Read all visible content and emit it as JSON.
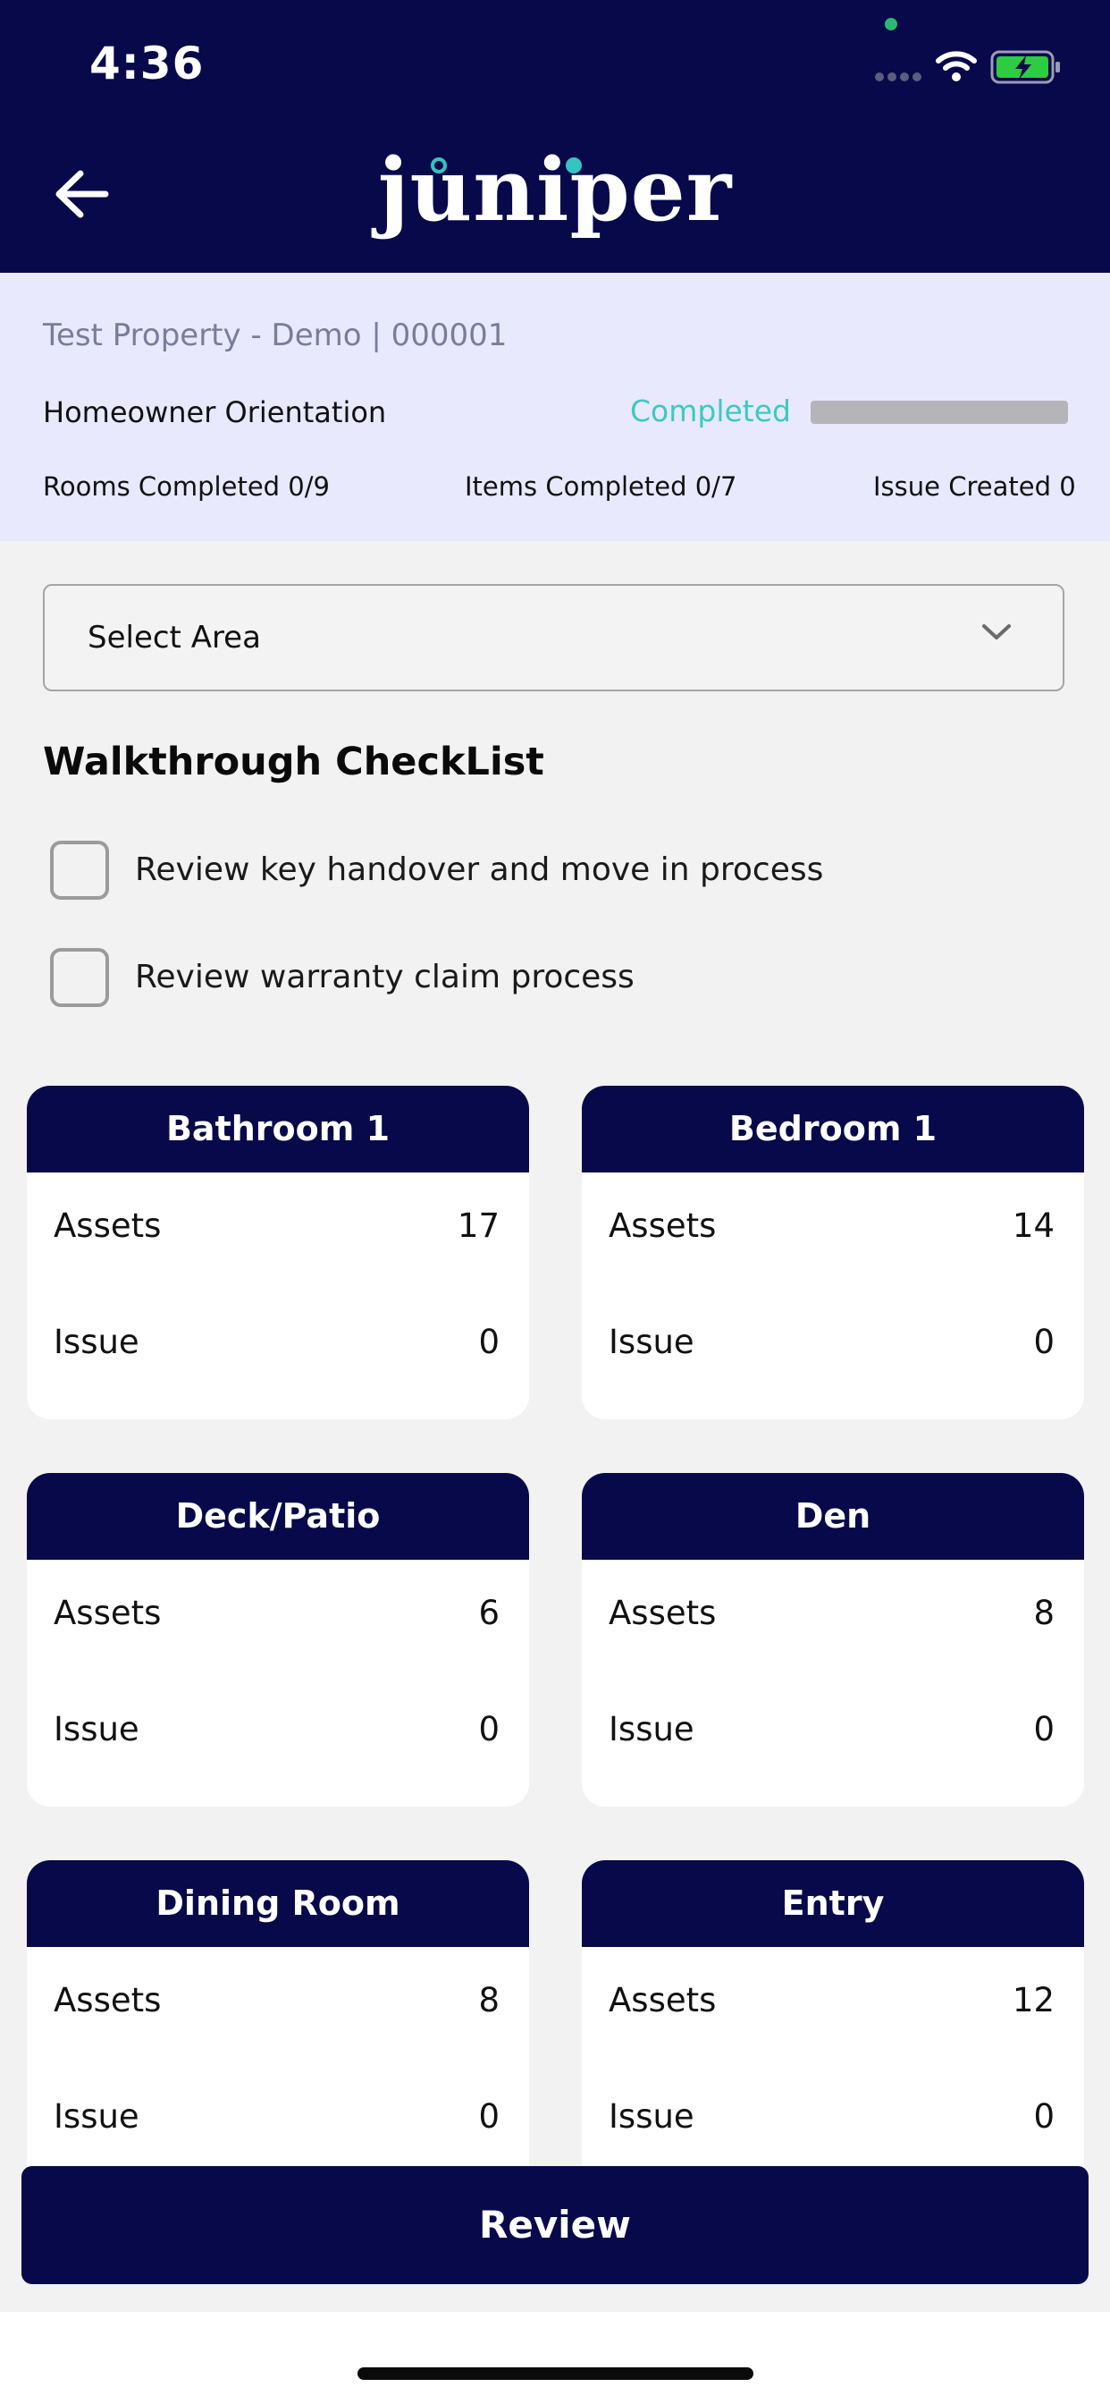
{
  "status_bar": {
    "time": "4:36"
  },
  "header": {
    "logo_text": "juniper"
  },
  "property": {
    "name": "Test Property - Demo | 000001",
    "task": "Homeowner Orientation",
    "status_label": "Completed",
    "progress_fraction": 0,
    "rooms_completed": "Rooms Completed 0/9",
    "items_completed": "Items Completed 0/7",
    "issues_created": "Issue Created 0"
  },
  "select_area": {
    "label": "Select Area"
  },
  "checklist": {
    "title": "Walkthrough CheckList",
    "items": [
      {
        "label": "Review key handover and move in process",
        "checked": false
      },
      {
        "label": "Review warranty claim process",
        "checked": false
      }
    ]
  },
  "rooms": [
    {
      "name": "Bathroom 1",
      "assets_label": "Assets",
      "assets": "17",
      "issue_label": "Issue",
      "issue": "0"
    },
    {
      "name": "Bedroom 1",
      "assets_label": "Assets",
      "assets": "14",
      "issue_label": "Issue",
      "issue": "0"
    },
    {
      "name": "Deck/Patio",
      "assets_label": "Assets",
      "assets": "6",
      "issue_label": "Issue",
      "issue": "0"
    },
    {
      "name": "Den",
      "assets_label": "Assets",
      "assets": "8",
      "issue_label": "Issue",
      "issue": "0"
    },
    {
      "name": "Dining Room",
      "assets_label": "Assets",
      "assets": "8",
      "issue_label": "Issue",
      "issue": "0"
    },
    {
      "name": "Entry",
      "assets_label": "Assets",
      "assets": "12",
      "issue_label": "Issue",
      "issue": "0"
    }
  ],
  "review_button": {
    "label": "Review"
  },
  "colors": {
    "navy": "#07094a",
    "teal": "#3ec9c0",
    "panel": "#e8e9fd"
  },
  "icons": [
    "back-arrow-icon",
    "chevron-down-icon",
    "wifi-icon",
    "battery-charging-icon",
    "cellular-signal-icon"
  ]
}
